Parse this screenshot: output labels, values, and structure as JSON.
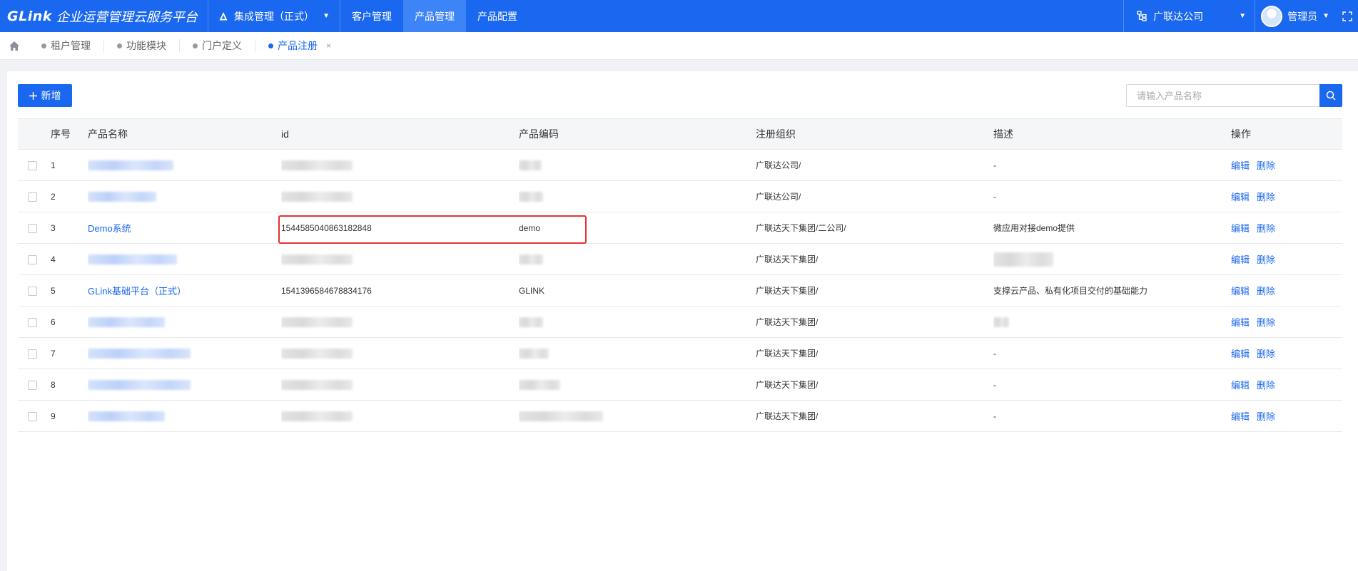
{
  "header": {
    "logo": "GLink",
    "app_title": "企业运营管理云服务平台",
    "system_select": "集成管理（正式）",
    "nav": [
      {
        "label": "客户管理",
        "active": false
      },
      {
        "label": "产品管理",
        "active": true
      },
      {
        "label": "产品配置",
        "active": false
      }
    ],
    "company": "广联达公司",
    "user": "管理员"
  },
  "tabs": [
    {
      "label": "租户管理",
      "active": false
    },
    {
      "label": "功能模块",
      "active": false
    },
    {
      "label": "门户定义",
      "active": false
    },
    {
      "label": "产品注册",
      "active": true,
      "close": "×"
    }
  ],
  "toolbar": {
    "add_label": "新增",
    "search_placeholder": "请输入产品名称"
  },
  "table": {
    "columns": [
      "序号",
      "产品名称",
      "id",
      "产品编码",
      "注册组织",
      "描述",
      "操作"
    ],
    "rows": [
      {
        "idx": "1",
        "name": "",
        "id": "",
        "code": "",
        "org": "广联达公司/",
        "desc": "-"
      },
      {
        "idx": "2",
        "name": "",
        "id": "",
        "code": "",
        "org": "广联达公司/",
        "desc": "-"
      },
      {
        "idx": "3",
        "name": "Demo系统",
        "id": "1544585040863182848",
        "code": "demo",
        "org": "广联达天下集团/二公司/",
        "desc": "微应用对接demo提供"
      },
      {
        "idx": "4",
        "name": "",
        "id": "",
        "code": "",
        "org": "广联达天下集团/",
        "desc": ""
      },
      {
        "idx": "5",
        "name": "GLink基础平台（正式）",
        "id": "1541396584678834176",
        "code": "GLINK",
        "org": "广联达天下集团/",
        "desc": "支撑云产品、私有化项目交付的基础能力"
      },
      {
        "idx": "6",
        "name": "",
        "id": "",
        "code": "",
        "org": "广联达天下集团/",
        "desc": ""
      },
      {
        "idx": "7",
        "name": "",
        "id": "",
        "code": "",
        "org": "广联达天下集团/",
        "desc": "-"
      },
      {
        "idx": "8",
        "name": "",
        "id": "",
        "code": "",
        "org": "广联达天下集团/",
        "desc": "-"
      },
      {
        "idx": "9",
        "name": "",
        "id": "",
        "code": "",
        "org": "广联达天下集团/",
        "desc": "-"
      }
    ],
    "actions": {
      "edit": "编辑",
      "delete": "删除"
    }
  },
  "colors": {
    "primary": "#1a67f0",
    "highlight_border": "#e63030"
  }
}
